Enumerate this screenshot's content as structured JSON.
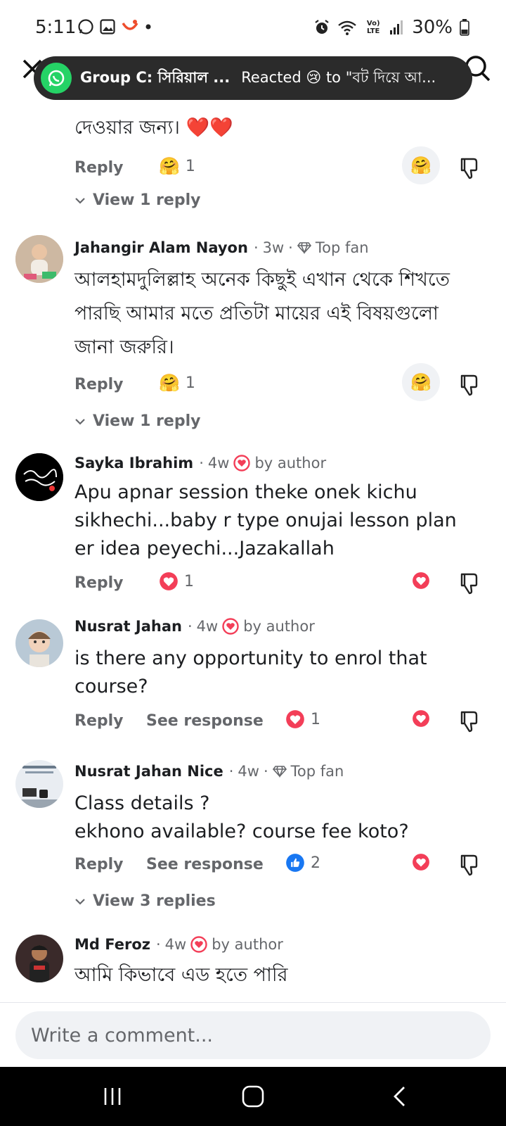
{
  "status_bar": {
    "time": "5:11",
    "battery": "30%",
    "lte_label": "Vo) LTE"
  },
  "notification": {
    "title": "Group C: সিরিয়াল ...",
    "text": "Reacted 😢 to \"বট দিয়ে আ..."
  },
  "colors": {
    "love": "#f33e58",
    "like": "#1877f2",
    "whatsapp": "#25d366",
    "secondary_text": "#65676b"
  },
  "comments": [
    {
      "body": "দেওয়ার জন্য। ❤️❤️",
      "reply_label": "Reply",
      "reaction_icon": "care-emoji-icon",
      "reaction_count": "1",
      "view_replies": "View 1 reply"
    },
    {
      "author": "Jahangir Alam Nayon",
      "time": "3w",
      "badge": "Top fan",
      "body": "আলহামদুলিল্লাহ অনেক কিছুই এখান থেকে শিখতে পারছি আমার মতে প্রতিটা মায়ের এই বিষয়গুলো জানা জরুরি।",
      "reply_label": "Reply",
      "reaction_icon": "care-emoji-icon",
      "reaction_count": "1",
      "view_replies": "View 1 reply"
    },
    {
      "author": "Sayka Ibrahim",
      "time": "4w",
      "badge": "by author",
      "body": "Apu apnar session theke onek kichu sikhechi...baby r type onujai lesson plan er idea peyechi...Jazakallah",
      "reply_label": "Reply",
      "reaction_icon": "love-icon",
      "reaction_count": "1"
    },
    {
      "author": "Nusrat Jahan",
      "time": "4w",
      "badge": "by author",
      "body": "is there any opportunity to enrol that course?",
      "reply_label": "Reply",
      "see_response": "See response",
      "reaction_icon": "love-icon",
      "reaction_count": "1"
    },
    {
      "author": "Nusrat Jahan Nice",
      "time": "4w",
      "badge": "Top fan",
      "body": "Class details ?\nekhono available? course fee koto?",
      "reply_label": "Reply",
      "see_response": "See response",
      "reaction_icon": "like-icon",
      "reaction_count": "2",
      "view_replies": "View 3 replies"
    },
    {
      "author": "Md Feroz",
      "time": "4w",
      "badge": "by author",
      "body": "আমি কিভাবে এড হতে পারি"
    }
  ],
  "composer": {
    "placeholder": "Write a comment..."
  }
}
